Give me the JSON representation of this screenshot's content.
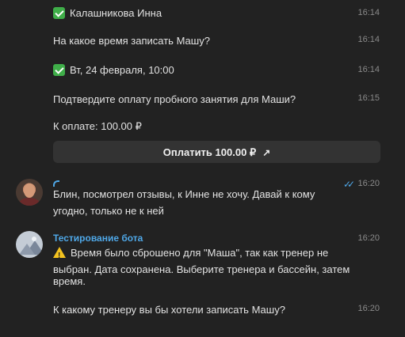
{
  "messages": {
    "m1": {
      "text": "Калашникова Инна",
      "time": "16:14"
    },
    "m2": {
      "text": "На какое время записать Машу?",
      "time": "16:14"
    },
    "m3": {
      "text": "Вт, 24 февраля, 10:00",
      "time": "16:14"
    },
    "m4": {
      "text": "Подтвердите оплату пробного занятия для Маши?",
      "time": "16:15"
    },
    "m5": {
      "text": "К оплате: 100.00 ₽"
    },
    "pay_button": {
      "label": "Оплатить 100.00 ₽",
      "icon": "↗"
    },
    "user_msg": {
      "line1": "Блин, посмотрел отзывы, к Инне не хочу. Давай к кому",
      "line2": "угодно, только не к ней",
      "time": "16:20",
      "status_icon": "✓✓"
    },
    "bot_msg": {
      "sender": "Тестирование бота",
      "line1": "Время было сброшено для \"Маша\", так как тренер не",
      "line2": "выбран. Дата сохранена. Выберите тренера и бассейн, затем",
      "line3": "время.",
      "time": "16:20"
    },
    "bot_msg2": {
      "text": "К какому тренеру вы бы хотели записать Машу?",
      "time": "16:20"
    }
  },
  "icons": {
    "check": "check-mark-icon",
    "warning": "warning-icon",
    "arrow": "arrow-up-right-icon",
    "read": "double-check-icon"
  },
  "colors": {
    "background": "#222222",
    "accent": "#4fa8e8",
    "check_green": "#3fae49",
    "button_bg": "#333333"
  }
}
